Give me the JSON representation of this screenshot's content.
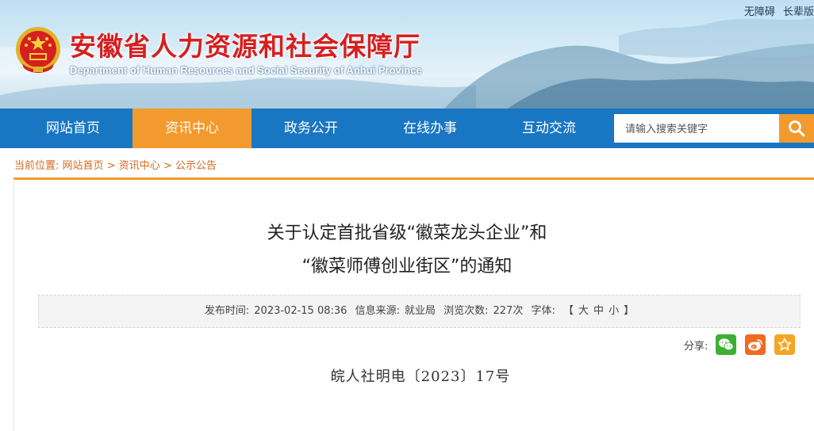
{
  "header": {
    "top_links": [
      "无障碍",
      "长辈版"
    ],
    "title": "安徽省人力资源和社会保障厅",
    "subtitle": "Department of Human Resources and Social Security of Anhui Province",
    "emblem_icon": "national-emblem-icon"
  },
  "nav": {
    "items": [
      "网站首页",
      "资讯中心",
      "政务公开",
      "在线办事",
      "互动交流"
    ],
    "active_index": 1,
    "search_placeholder": "请输入搜索关键字",
    "search_icon": "search-icon"
  },
  "breadcrumb": {
    "prefix": "当前位置:",
    "items": [
      "网站首页",
      "资讯中心",
      "公示公告"
    ],
    "separator": ">"
  },
  "article": {
    "title_line1": "关于认定首批省级“徽菜龙头企业”和",
    "title_line2": "“徽菜师傅创业街区”的通知",
    "meta": {
      "publish_label": "发布时间:",
      "publish_time": "2023-02-15 08:36",
      "source_label": "信息来源:",
      "source": "就业局",
      "views_label": "浏览次数:",
      "views": "227次",
      "font_label": "字体:",
      "font_open": "【",
      "font_large": "大",
      "font_medium": "中",
      "font_small": "小",
      "font_close": "】"
    },
    "share_label": "分享:",
    "share_icons": [
      "wechat-icon",
      "weibo-icon",
      "favorite-star-icon"
    ],
    "doc_number": "皖人社明电〔2023〕17号"
  },
  "colors": {
    "nav_blue": "#1976c3",
    "accent_orange": "#f29a2e",
    "title_red": "#d61f1f",
    "wechat_green": "#3cb034",
    "weibo_orange": "#f06a22",
    "star_orange": "#f5a623"
  }
}
